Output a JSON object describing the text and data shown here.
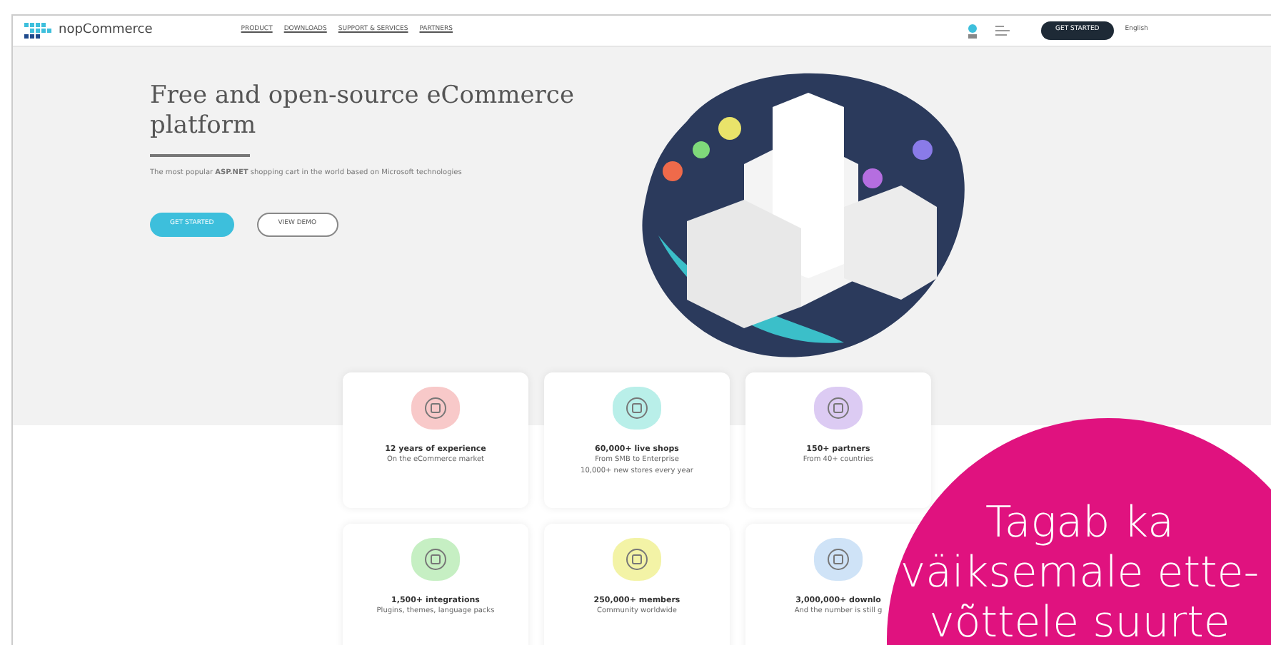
{
  "header": {
    "logo": "nopCommerce",
    "nav": [
      "PRODUCT",
      "DOWNLOADS",
      "SUPPORT & SERVICES",
      "PARTNERS"
    ],
    "cta": "GET STARTED",
    "language": "English"
  },
  "hero": {
    "title": "Free and open-source eCommerce platform",
    "subtitle": "The most popular **ASP.NET** shopping cart in the world based on Microsoft technologies",
    "buttons": [
      {
        "label": "GET STARTED",
        "kind": "primary"
      },
      {
        "label": "VIEW DEMO",
        "kind": "outline"
      }
    ]
  },
  "stats": [
    {
      "title": "12 years of experience",
      "lines": [
        "On the eCommerce market"
      ],
      "color": "#f8c9c9"
    },
    {
      "title": "60,000+ live shops",
      "lines": [
        "From SMB to Enterprise",
        "10,000+ new stores every year"
      ],
      "color": "#b9efe9"
    },
    {
      "title": "150+ partners",
      "lines": [
        "From 40+ countries"
      ],
      "color": "#dccbf3"
    },
    {
      "title": "1,500+ integrations",
      "lines": [
        "Plugins, themes, language packs"
      ],
      "color": "#c6efc3"
    },
    {
      "title": "250,000+ members",
      "lines": [
        "Community worldwide"
      ],
      "color": "#f3f3a6"
    },
    {
      "title": "3,000,000+ downlo",
      "lines": [
        "And the number is still g"
      ],
      "color": "#cfe3f7"
    }
  ],
  "callout": {
    "lines": [
      "Tagab ka",
      "väiksemale ette-",
      "võttele suurte"
    ]
  }
}
